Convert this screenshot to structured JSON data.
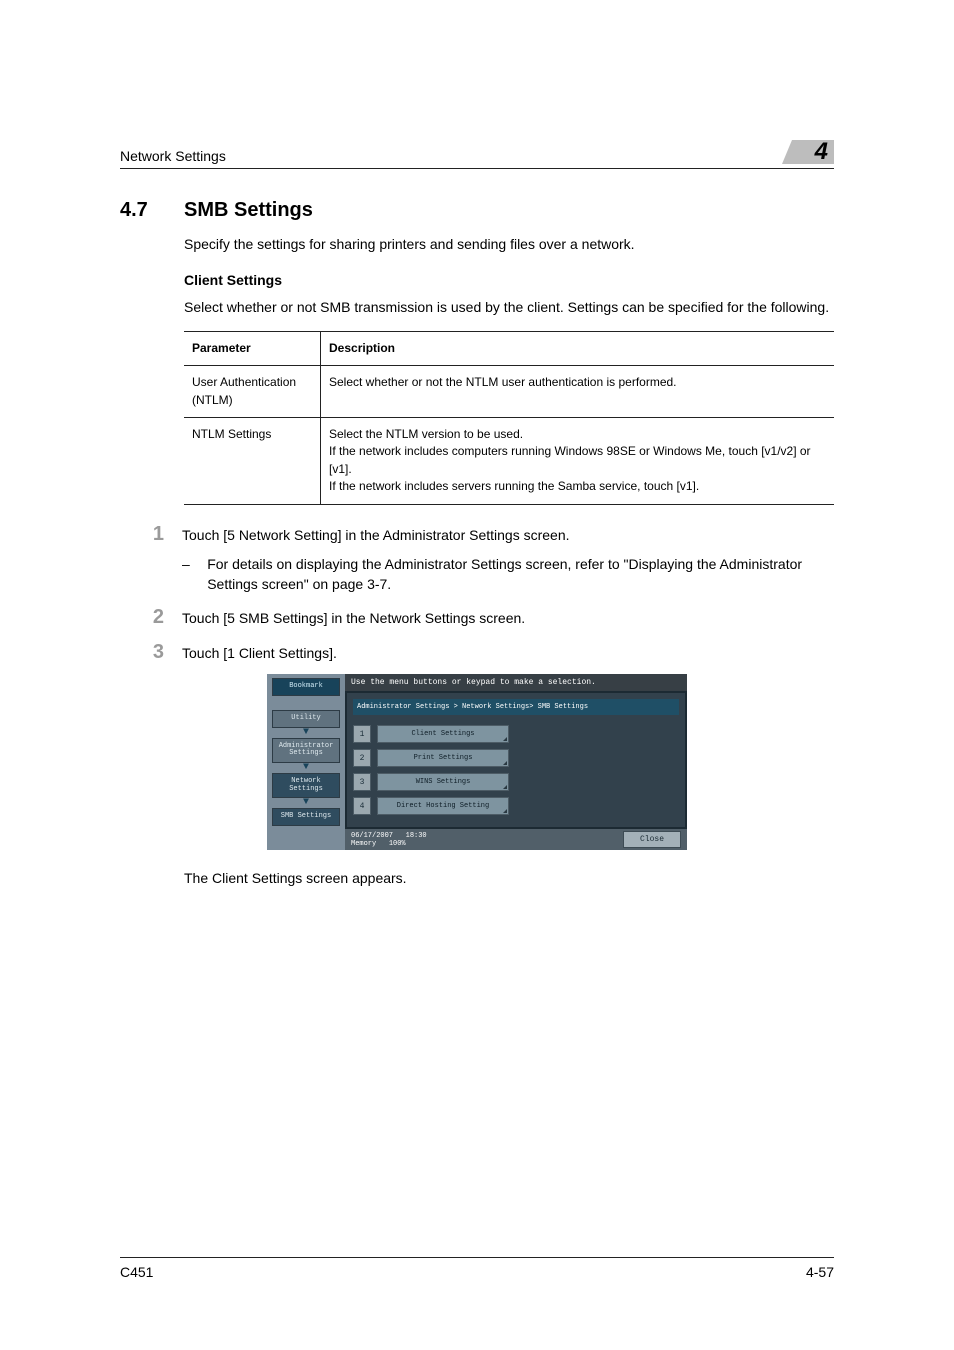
{
  "header": {
    "section_title": "Network Settings",
    "chapter_number": "4"
  },
  "section": {
    "number": "4.7",
    "title": "SMB Settings",
    "intro": "Specify the settings for sharing printers and sending files over a network."
  },
  "client": {
    "heading": "Client Settings",
    "desc": "Select whether or not SMB transmission is used by the client. Settings can be specified for the following."
  },
  "table": {
    "h1": "Parameter",
    "h2": "Description",
    "rows": [
      {
        "p": "User Authentication (NTLM)",
        "d": "Select whether or not the NTLM user authentication is performed."
      },
      {
        "p": "NTLM Settings",
        "d": "Select the NTLM version to be used.\nIf the network includes computers running Windows 98SE or Windows Me, touch [v1/v2] or [v1].\nIf the network includes servers running the Samba service, touch [v1]."
      }
    ]
  },
  "steps": {
    "s1": "Touch [5 Network Setting] in the Administrator Settings screen.",
    "s1_sub": "For details on displaying the Administrator Settings screen, refer to \"Displaying the Administrator Settings screen\" on page 3-7.",
    "s2": "Touch [5 SMB Settings] in the Network Settings screen.",
    "s3": "Touch [1 Client Settings].",
    "after_text": "The Client Settings screen appears."
  },
  "shot": {
    "instr": "Use the menu buttons or keypad to make a selection.",
    "bookmark": "Bookmark",
    "left": {
      "utility": "Utility",
      "admin": "Administrator Settings",
      "network": "Network Settings",
      "smb": "SMB Settings"
    },
    "crumb": "Administrator Settings > Network Settings> SMB Settings",
    "menu": [
      {
        "n": "1",
        "t": "Client Settings"
      },
      {
        "n": "2",
        "t": "Print Settings"
      },
      {
        "n": "3",
        "t": "WINS Settings"
      },
      {
        "n": "4",
        "t": "Direct Hosting Setting"
      }
    ],
    "footer": {
      "date": "06/17/2007",
      "time": "18:30",
      "mem_label": "Memory",
      "mem_val": "100%",
      "close": "Close"
    }
  },
  "footer": {
    "model": "C451",
    "page": "4-57"
  }
}
